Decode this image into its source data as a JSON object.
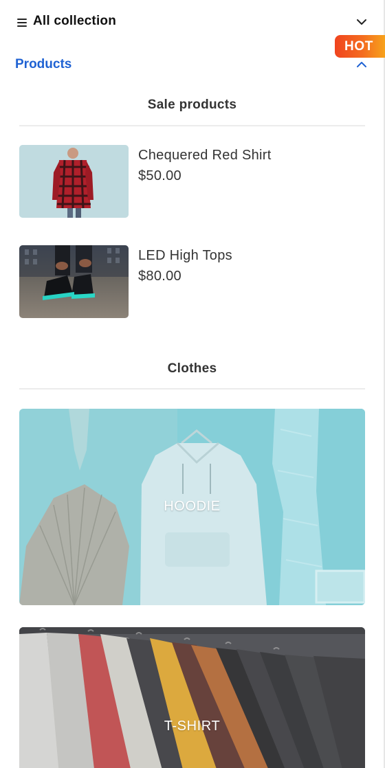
{
  "header": {
    "title": "All collection",
    "menu_icon": "hamburger-menu-icon",
    "collapse_icon": "chevron-down-icon"
  },
  "badge": {
    "label": "HOT",
    "colors": [
      "#f0441f",
      "#f7a21c"
    ]
  },
  "products_nav": {
    "label": "Products",
    "expanded_icon": "chevron-up-icon",
    "accent_color": "#1f62d3"
  },
  "sale_section": {
    "title": "Sale products",
    "items": [
      {
        "name": "Chequered Red Shirt",
        "price": "$50.00",
        "image": "red-plaid-shirt-photo"
      },
      {
        "name": "LED High Tops",
        "price": "$80.00",
        "image": "led-sneakers-photo"
      }
    ]
  },
  "clothes_section": {
    "title": "Clothes",
    "categories": [
      {
        "label": "HOODIE",
        "image": "white-hoodie-photo"
      },
      {
        "label": "T-SHIRT",
        "image": "tshirt-rack-photo"
      }
    ]
  }
}
